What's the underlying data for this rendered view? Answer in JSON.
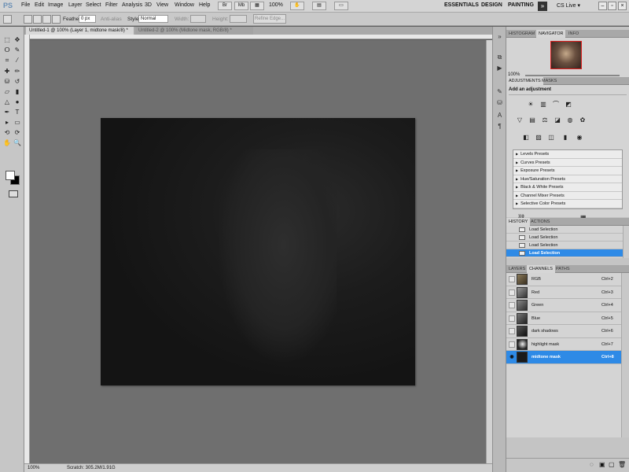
{
  "app": {
    "logo": "PS"
  },
  "menu": [
    "File",
    "Edit",
    "Image",
    "Layer",
    "Select",
    "Filter",
    "Analysis",
    "3D",
    "View",
    "Window",
    "Help"
  ],
  "zoom_display": "100%",
  "workspaces": {
    "essentials": "ESSENTIALS",
    "design": "DESIGN",
    "painting": "PAINTING",
    "more": "»"
  },
  "cs_live": "CS Live ▾",
  "window_buttons": {
    "minimize": "–",
    "restore": "▫",
    "close": "×"
  },
  "options": {
    "feather_label": "Feather:",
    "feather_value": "0 px",
    "antialias_label": "Anti-alias",
    "style_label": "Style:",
    "style_value": "Normal",
    "width_label": "Width:",
    "height_label": "Height:",
    "refine_edge": "Refine Edge..."
  },
  "documents": [
    {
      "title": "Untitled-1 @ 100% (Layer 1, midtone mask/8) *"
    },
    {
      "title": "Untitled-2 @ 100% (Midtone mask, RGB/8) *"
    }
  ],
  "status": {
    "zoom": "100%",
    "scratch": "Scratch: 305.2M/1.91G"
  },
  "navigator": {
    "tabs": [
      "HISTOGRAM",
      "NAVIGATOR",
      "INFO"
    ],
    "active": "NAVIGATOR",
    "zoom": "100%"
  },
  "adjustments": {
    "tabs": [
      "ADJUSTMENTS",
      "MASKS"
    ],
    "title": "Add an adjustment",
    "presets": [
      "Levels Presets",
      "Curves Presets",
      "Exposure Presets",
      "Hue/Saturation Presets",
      "Black & White Presets",
      "Channel Mixer Presets",
      "Selective Color Presets"
    ]
  },
  "history": {
    "tabs": [
      "HISTORY",
      "ACTIONS"
    ],
    "rows": [
      "Load Selection",
      "Load Selection",
      "Load Selection",
      "Load Selection"
    ]
  },
  "channels": {
    "tabs": [
      "LAYERS",
      "CHANNELS",
      "PATHS"
    ],
    "rows": [
      {
        "name": "RGB",
        "shortcut": "Ctrl+2"
      },
      {
        "name": "Red",
        "shortcut": "Ctrl+3"
      },
      {
        "name": "Green",
        "shortcut": "Ctrl+4"
      },
      {
        "name": "Blue",
        "shortcut": "Ctrl+5"
      },
      {
        "name": "dark shadows",
        "shortcut": "Ctrl+6"
      },
      {
        "name": "highlight mask",
        "shortcut": "Ctrl+7"
      },
      {
        "name": "midtone mask",
        "shortcut": "Ctrl+8"
      }
    ]
  },
  "colors": {
    "selection": "#2e8ae6",
    "navigator_frame": "#dd2222"
  }
}
